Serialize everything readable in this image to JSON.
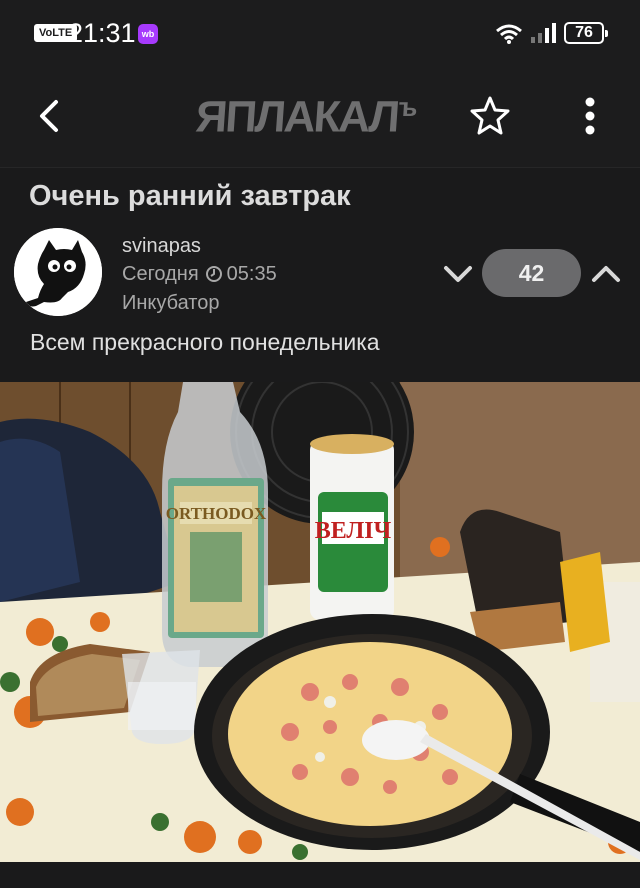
{
  "status_bar": {
    "volte": "VoLTE",
    "time": "21:31",
    "app_badge": "wb",
    "battery": "76"
  },
  "header": {
    "logo_text": "ЯПЛАКАЛ",
    "logo_suffix": "ъ"
  },
  "post": {
    "title": "Очень ранний завтрак",
    "author": "svinapas",
    "date": "Сегодня",
    "time": "05:35",
    "rank": "Инкубатор",
    "score": "42",
    "text": "Всем прекрасного понедельника"
  },
  "photo": {
    "bottle_label": "ORTHODOX",
    "can_label": "ВЕЛІЧ"
  }
}
